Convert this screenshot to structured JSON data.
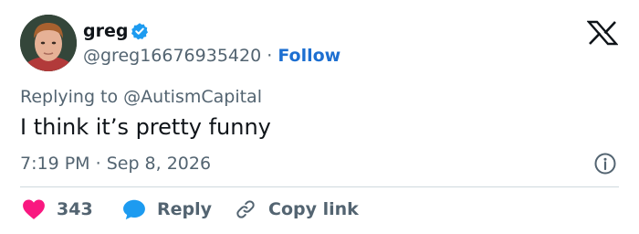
{
  "author": {
    "display_name": "greg",
    "handle": "@greg16676935420",
    "separator": "·",
    "follow_label": "Follow"
  },
  "tweet": {
    "replying_prefix": "Replying to",
    "replying_to": "@AutismCapital",
    "text": "I think it’s pretty funny",
    "time": "7:19 PM",
    "date": "Sep 8, 2026"
  },
  "actions": {
    "like_count": "343",
    "reply_label": "Reply",
    "copy_link_label": "Copy link"
  },
  "icons": {
    "verified": "verified-badge-icon",
    "logo": "x-logo-icon",
    "info": "info-icon",
    "like": "heart-icon",
    "reply": "speech-bubble-icon",
    "copy_link": "link-icon"
  },
  "colors": {
    "accent_blue": "#1d9bf0",
    "follow_blue": "#1d6fd1",
    "heart_pink": "#f91880",
    "secondary_text": "#536471",
    "primary_text": "#0f1419",
    "divider": "#cfd9de"
  }
}
